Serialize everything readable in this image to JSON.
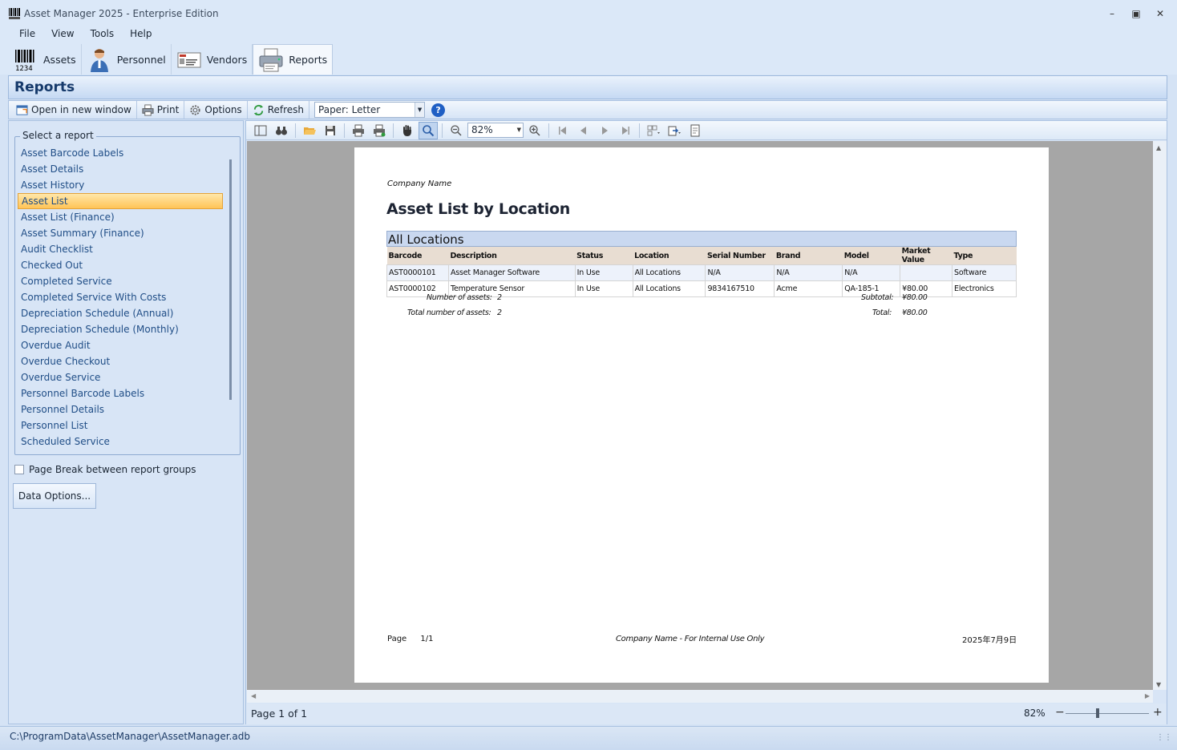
{
  "window": {
    "title": "Asset Manager 2025 - Enterprise Edition"
  },
  "menu": [
    "File",
    "View",
    "Tools",
    "Help"
  ],
  "modules": [
    {
      "label": "Assets",
      "icon": "barcode-icon"
    },
    {
      "label": "Personnel",
      "icon": "person-icon"
    },
    {
      "label": "Vendors",
      "icon": "vendor-card-icon"
    },
    {
      "label": "Reports",
      "icon": "printer-icon"
    }
  ],
  "section": {
    "title": "Reports"
  },
  "actionbar": {
    "open_new_window": "Open in new window",
    "print": "Print",
    "options": "Options",
    "refresh": "Refresh",
    "paper": "Paper: Letter"
  },
  "reports_panel": {
    "legend": "Select a report",
    "items": [
      "Asset Barcode Labels",
      "Asset Details",
      "Asset History",
      "Asset List",
      "Asset List (Finance)",
      "Asset Summary (Finance)",
      "Audit Checklist",
      "Checked Out",
      "Completed Service",
      "Completed Service With Costs",
      "Depreciation Schedule (Annual)",
      "Depreciation Schedule (Monthly)",
      "Overdue Audit",
      "Overdue Checkout",
      "Overdue Service",
      "Personnel Barcode Labels",
      "Personnel Details",
      "Personnel List",
      "Scheduled Service"
    ],
    "selected": "Asset List",
    "page_break_label": "Page Break between report groups",
    "page_break_checked": false,
    "data_options": "Data Options..."
  },
  "preview": {
    "zoom": "82%",
    "page_label": "Page 1 of 1",
    "status_zoom": "82%",
    "zoom_fraction": 0.38
  },
  "report": {
    "company": "Company Name",
    "title": "Asset List by Location",
    "group": "All Locations",
    "columns": [
      "Barcode",
      "Description",
      "Status",
      "Location",
      "Serial Number",
      "Brand",
      "Model",
      "Market Value",
      "Type"
    ],
    "rows": [
      [
        "AST0000101",
        "Asset Manager Software",
        "In Use",
        "All Locations",
        "N/A",
        "N/A",
        "N/A",
        "",
        "Software"
      ],
      [
        "AST0000102",
        "Temperature Sensor",
        "In Use",
        "All Locations",
        "9834167510",
        "Acme",
        "QA-185-1",
        "¥80.00",
        "Electronics"
      ]
    ],
    "number_assets_label": "Number of assets:",
    "number_assets": "2",
    "subtotal_label": "Subtotal:",
    "subtotal": "¥80.00",
    "total_assets_label": "Total number of assets:",
    "total_assets": "2",
    "total_label": "Total:",
    "total": "¥80.00",
    "footer_page": "Page",
    "footer_page_num": "1/1",
    "footer_center": "Company Name - For Internal Use Only",
    "footer_date": "2025年7月9日"
  },
  "statusbar": {
    "path": "C:\\ProgramData\\AssetManager\\AssetManager.adb"
  }
}
